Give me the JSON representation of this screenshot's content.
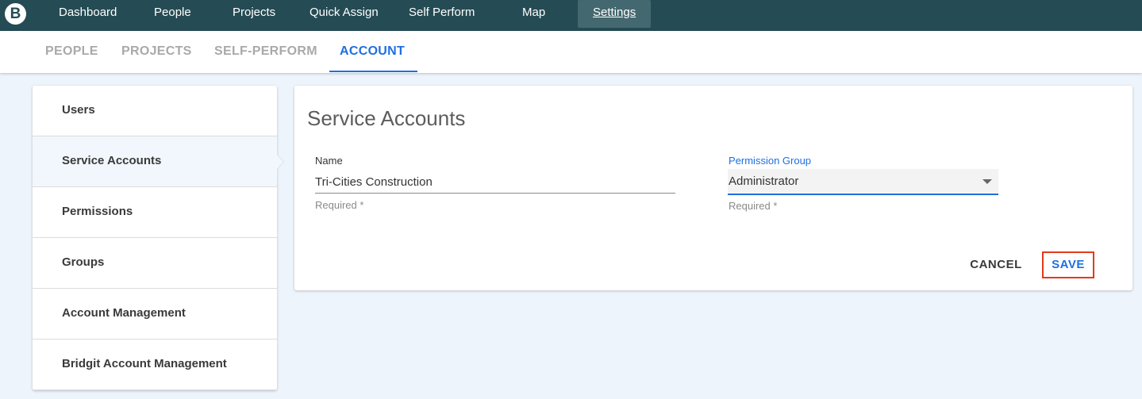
{
  "app": {
    "logo_letter": "B"
  },
  "topnav": {
    "items": [
      {
        "label": "Dashboard"
      },
      {
        "label": "People"
      },
      {
        "label": "Projects"
      },
      {
        "label": "Quick Assign"
      },
      {
        "label": "Self Perform"
      },
      {
        "label": "Map"
      },
      {
        "label": "Settings",
        "active": true
      }
    ]
  },
  "subtabs": {
    "items": [
      {
        "label": "PEOPLE"
      },
      {
        "label": "PROJECTS"
      },
      {
        "label": "SELF-PERFORM"
      },
      {
        "label": "ACCOUNT",
        "active": true
      }
    ]
  },
  "sidemenu": {
    "items": [
      {
        "label": "Users"
      },
      {
        "label": "Service Accounts",
        "selected": true
      },
      {
        "label": "Permissions"
      },
      {
        "label": "Groups"
      },
      {
        "label": "Account Management"
      },
      {
        "label": "Bridgit Account Management"
      }
    ]
  },
  "form": {
    "title": "Service Accounts",
    "name_label": "Name",
    "name_value": "Tri-Cities Construction",
    "name_helper": "Required *",
    "permission_label": "Permission Group",
    "permission_value": "Administrator",
    "permission_helper": "Required *",
    "cancel_label": "CANCEL",
    "save_label": "SAVE"
  },
  "colors": {
    "topnav_bg": "#254c54",
    "accent_blue": "#1f6fe0",
    "highlight_red": "#e23a1d",
    "page_bg": "#eef4fc"
  }
}
